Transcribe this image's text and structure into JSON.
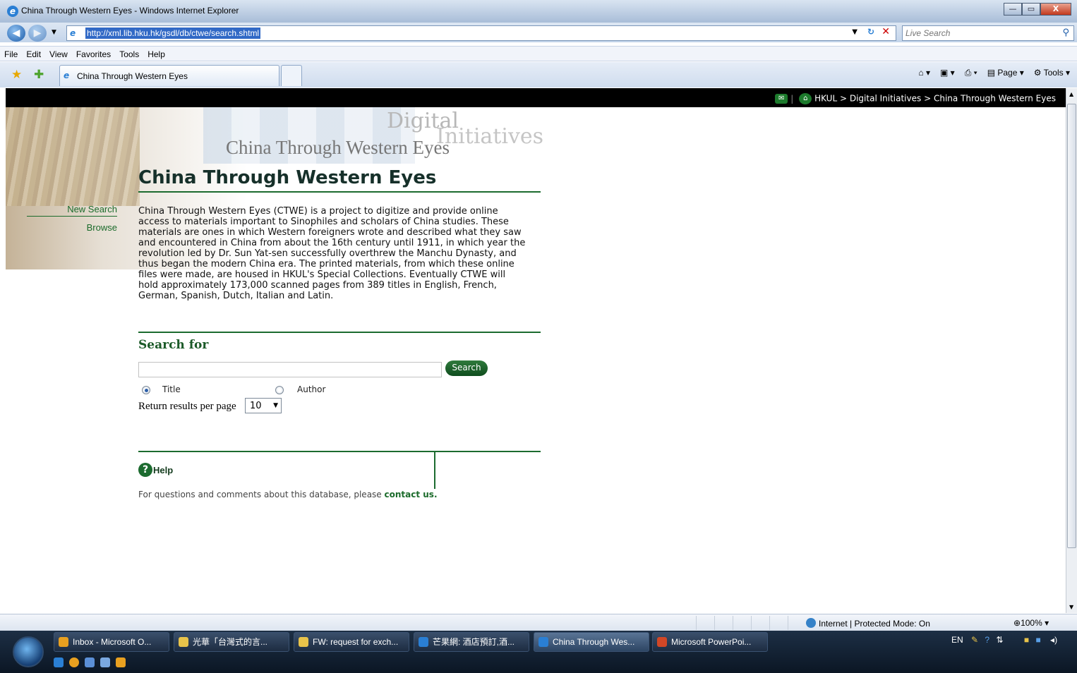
{
  "window": {
    "title": "China Through Western Eyes - Windows Internet Explorer",
    "min": "—",
    "max": "▭",
    "close": "X"
  },
  "address": {
    "url": "http://xml.lib.hku.hk/gsdl/db/ctwe/search.shtml",
    "search_placeholder": "Live Search"
  },
  "menu": [
    "File",
    "Edit",
    "View",
    "Favorites",
    "Tools",
    "Help"
  ],
  "tab": {
    "label": "China Through Western Eyes"
  },
  "command_bar": {
    "page": "Page",
    "tools": "Tools"
  },
  "breadcrumb": {
    "hkul": "HKUL",
    "sep1": ">",
    "di": "Digital Initiatives",
    "sep2": ">",
    "current": "China Through Western Eyes"
  },
  "banner": {
    "digital": "Digital",
    "initiatives": "Initiatives",
    "subtitle": "China Through Western Eyes"
  },
  "page": {
    "title": "China Through Western Eyes",
    "intro": "China Through Western Eyes (CTWE) is a project to digitize and provide online access to materials important to Sinophiles and scholars of China studies. These materials are ones in which Western foreigners wrote and described what they saw and encountered in China from about the 16th century until 1911, in which year the revolution led by Dr. Sun Yat-sen successfully overthrew the Manchu Dynasty, and thus began the modern China era. The printed materials, from which these online files were made, are housed in HKUL's Special Collections. Eventually CTWE will hold approximately 173,000 scanned pages from 389 titles in English, French, German, Spanish, Dutch, Italian and Latin."
  },
  "sidebar": {
    "new_search": "New Search",
    "browse": "Browse"
  },
  "search": {
    "heading": "Search for",
    "query_value": "",
    "button": "Search",
    "options": {
      "title": "Title",
      "author": "Author",
      "selected": "Title"
    },
    "per_page_label": "Return results per page",
    "per_page_value": "10"
  },
  "help": {
    "label": "Help",
    "text": "For questions and comments about this database, please ",
    "link": "contact us."
  },
  "status": {
    "zone": "Internet | Protected Mode: On",
    "zoom": "100%"
  },
  "taskbar": {
    "buttons": [
      {
        "label": "Inbox - Microsoft O...",
        "color": "#e8a020"
      },
      {
        "label": "光華「台灣式的言...",
        "color": "#e8c34a"
      },
      {
        "label": "FW: request for exch...",
        "color": "#e8c34a"
      },
      {
        "label": "芒果網: 酒店預訂,酒...",
        "color": "#2a7fd4"
      },
      {
        "label": "China Through Wes...",
        "color": "#2a7fd4"
      },
      {
        "label": "Microsoft PowerPoi...",
        "color": "#d24726"
      }
    ],
    "tray_lang": "EN"
  },
  "colors": {
    "accent": "#1b6b2b",
    "black_bar": "#000000"
  }
}
